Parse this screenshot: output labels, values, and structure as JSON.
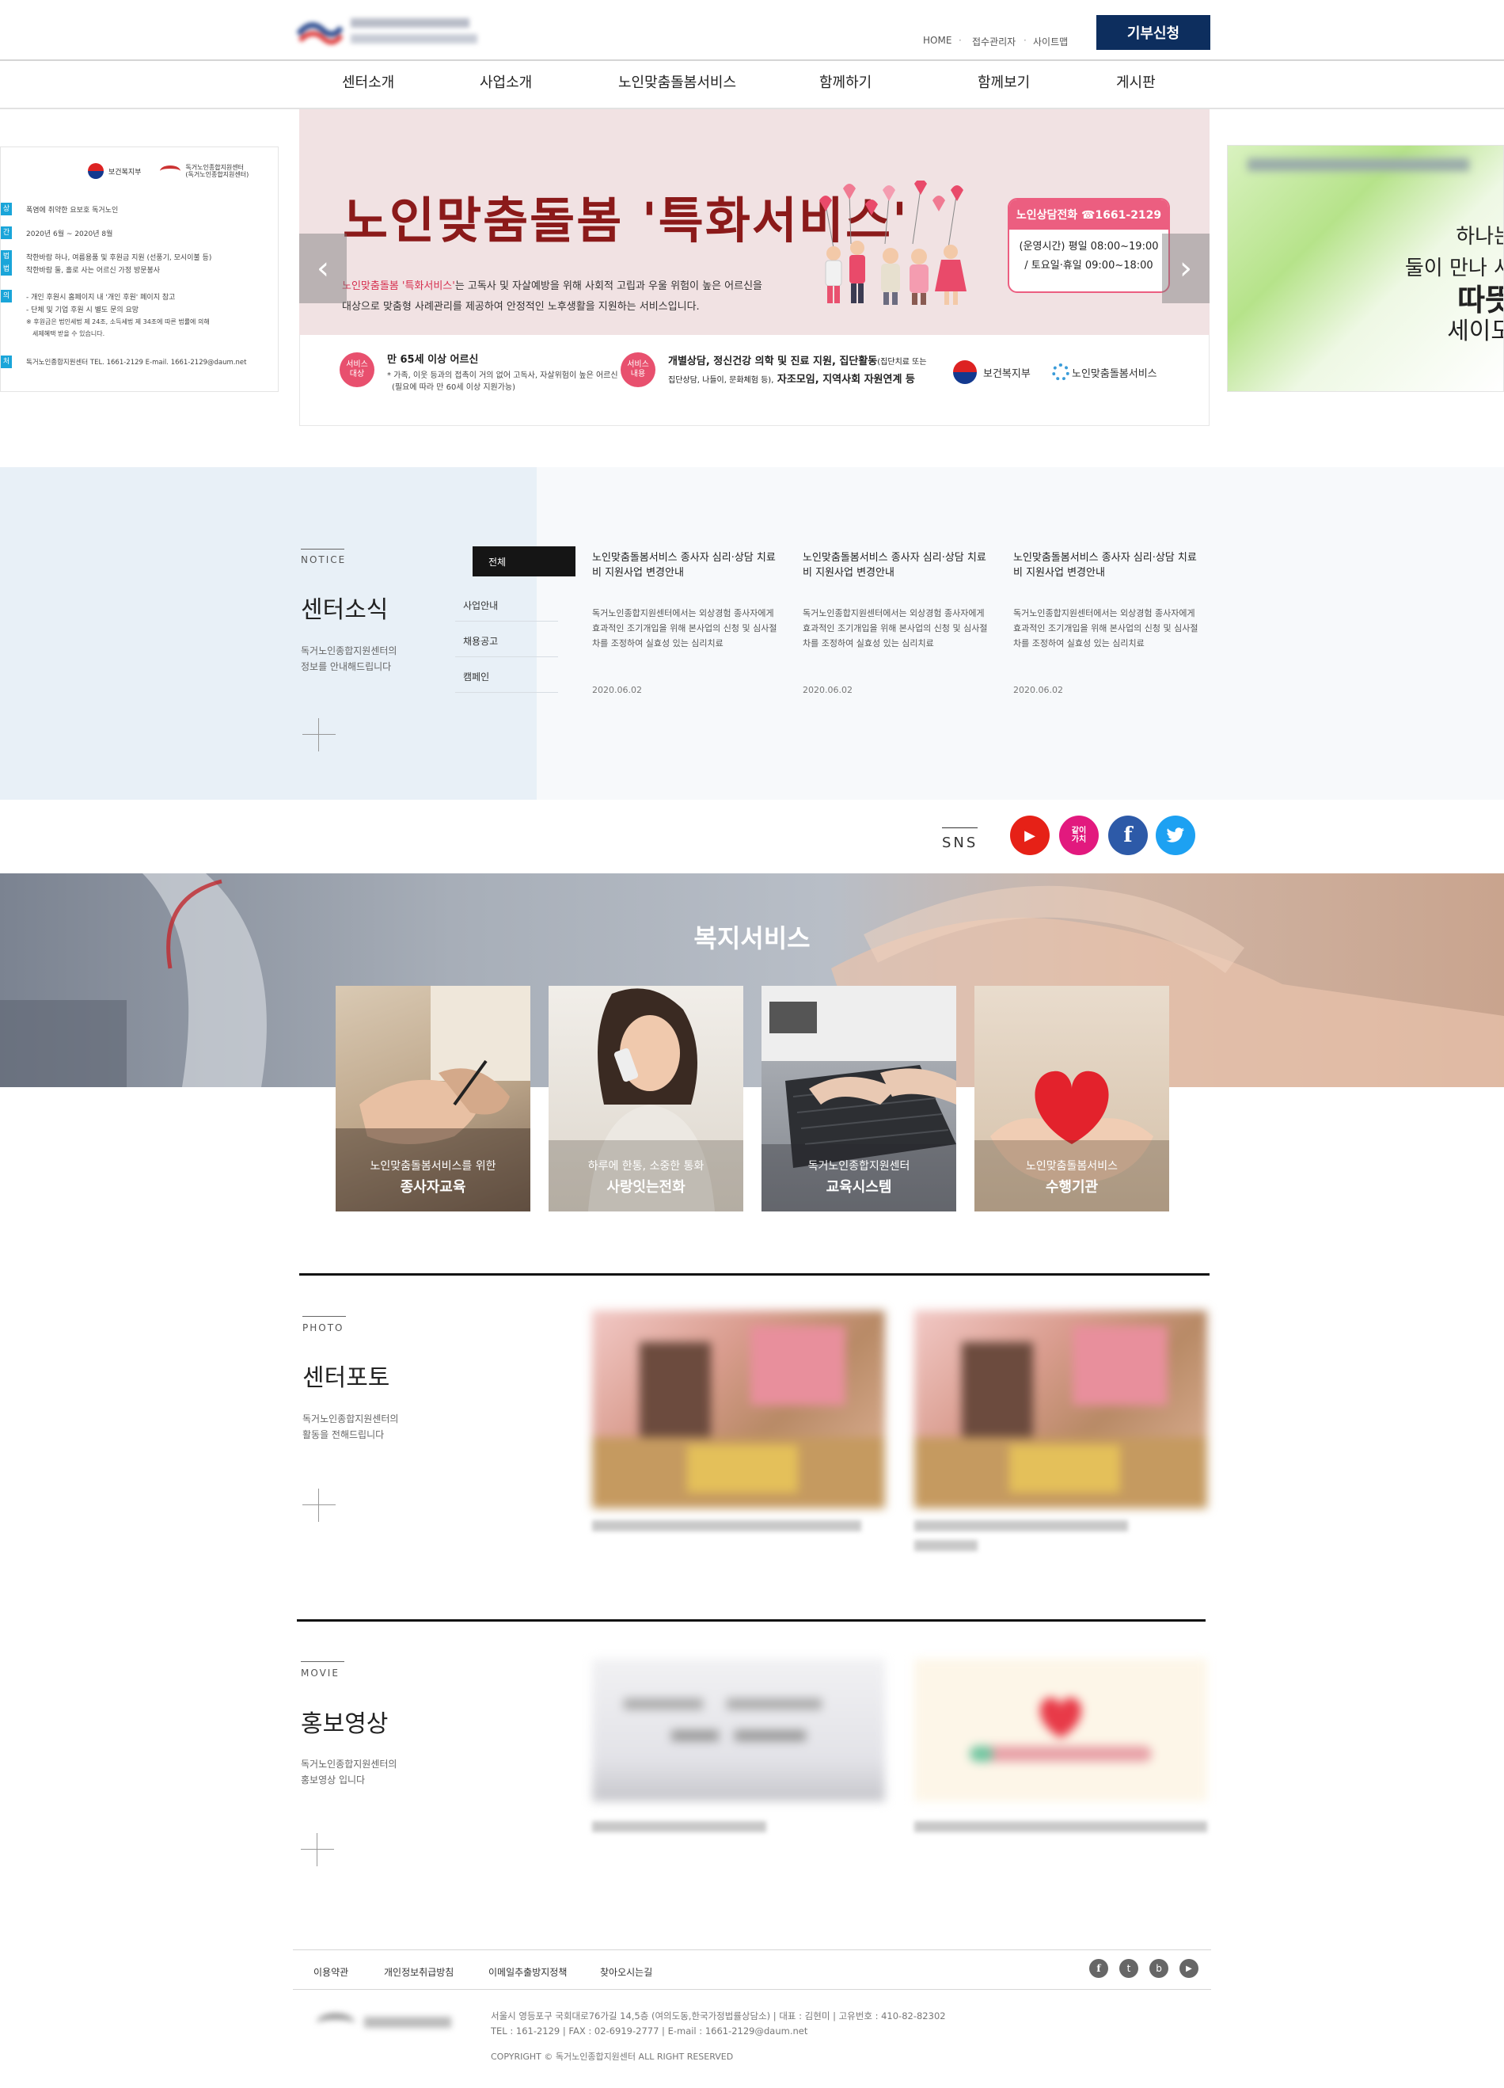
{
  "header": {
    "util_links": [
      "HOME",
      "접수관리자",
      "사이트맵"
    ],
    "donate_label": "기부신청",
    "gnb": [
      "센터소개",
      "사업소개",
      "노인맞춤돌봄서비스",
      "함께하기",
      "함께보기",
      "게시판"
    ]
  },
  "left_card": {
    "org1": "보건복지부",
    "org2": "독거노인종합지원센터",
    "org2_sub": "(독거노인종합지원센터)",
    "lines": [
      "폭염에 취약한 요보호 독거노인",
      "2020년 6월 ~ 2020년 8월",
      "착한바람 하나, 여름용품 및 후원금 지원 (선풍기, 모시이불 등)",
      "착한바람 둘, 홀로 사는 어르신 가정 방문봉사",
      "- 개인 후원시 홈페이지 내 '개인 후원' 페이지 참고",
      "- 단체 및 기업 후원 시 별도 문의 요망",
      "※ 후원금은 법인세법 제 24조, 소득세법 제 34조에 따른 법률에 의해",
      "세제혜택 받을 수 있습니다.",
      "독거노인종합지원센터  TEL. 1661-2129   E-mail. 1661-2129@daum.net"
    ],
    "tags": [
      "상",
      "간",
      "법",
      "법",
      "의",
      "처"
    ]
  },
  "banner": {
    "title": "노인맞춤돌봄 '특화서비스'",
    "desc_highlight": "노인맞춤돌봄 '특화서비스'",
    "desc_rest_1": "는 고독사 및 자살예방을 위해 사회적 고립과 우울 위험이 높은 어르신을",
    "desc_line_2": "대상으로 맞춤형 사례관리를 제공하여 안정적인 노후생활을 지원하는 서비스입니다.",
    "phone_head": "노인상담전화 ☎1661-2129",
    "phone_line1": "(운영시간) 평일 08:00~19:00",
    "phone_line2": "/ 토요일·휴일 09:00~18:00",
    "badge1": "서비스\n대상",
    "target_title": "만 65세 이상 어르신",
    "target_desc1": "* 가족, 이웃 등과의 접촉이 거의 없어 고독사, 자살위험이 높은 어르신",
    "target_desc2": "(필요에 따라 만 60세 이상 지원가능)",
    "badge2": "서비스\n내용",
    "content_title_bold": "개별상담, 정신건강 의학 및 진료 지원, 집단활동",
    "content_title_small": "(집단치료 또는",
    "content_line2_small": "집단상담, 나들이, 문화체험 등),",
    "content_line2_bold": " 자조모임, 지역사회 자원연계 등",
    "logo1": "보건복지부",
    "logo2": "노인맞춤돌봄서비스",
    "prev": "‹",
    "next": "›"
  },
  "right_card": {
    "text1": "하나는",
    "text2": "둘이 만나 사",
    "text3": "따뜻",
    "text4": "세이도"
  },
  "notice": {
    "eng": "NOTICE",
    "title": "센터소식",
    "desc1": "독거노인종합지원센터의",
    "desc2": "정보를 안내해드립니다",
    "tabs": [
      "전체",
      "사업안내",
      "채용공고",
      "캠페인"
    ],
    "posts": [
      {
        "title": "노인맞춤돌봄서비스 종사자 심리·상담 치료비 지원사업 변경안내",
        "body": "독거노인종합지원센터에서는 외상경험 종사자에게 효과적인 조기개입을 위해 본사업의 신청 및 심사절차를 조정하여 실효성 있는 심리치료",
        "date": "2020.06.02"
      },
      {
        "title": "노인맞춤돌봄서비스 종사자 심리·상담 치료비 지원사업 변경안내",
        "body": "독거노인종합지원센터에서는 외상경험 종사자에게 효과적인 조기개입을 위해 본사업의 신청 및 심사절차를 조정하여 실효성 있는 심리치료",
        "date": "2020.06.02"
      },
      {
        "title": "노인맞춤돌봄서비스 종사자 심리·상담 치료비 지원사업 변경안내",
        "body": "독거노인종합지원센터에서는 외상경험 종사자에게 효과적인 조기개입을 위해 본사업의 신청 및 심사절차를 조정하여 실효성 있는 심리치료",
        "date": "2020.06.02"
      }
    ]
  },
  "sns": {
    "label": "SNS",
    "kakao_label": "같이\n가치",
    "youtube": "▶",
    "facebook": "f",
    "twitter": "🐦"
  },
  "welfare": {
    "title": "복지서비스",
    "cards": [
      {
        "sub": "노인맞춤돌봄서비스를 위한",
        "name": "종사자교육"
      },
      {
        "sub": "하루에 한통, 소중한 통화",
        "name": "사랑잇는전화"
      },
      {
        "sub": "독거노인종합지원센터",
        "name": "교육시스템"
      },
      {
        "sub": "노인맞춤돌봄서비스",
        "name": "수행기관"
      }
    ]
  },
  "photo": {
    "eng": "PHOTO",
    "title": "센터포토",
    "desc1": "독거노인종합지원센터의",
    "desc2": "활동을 전해드립니다"
  },
  "movie": {
    "eng": "MOVIE",
    "title": "홍보영상",
    "desc1": "독거노인종합지원센터의",
    "desc2": "홍보영상 입니다"
  },
  "footer": {
    "links": [
      "이용약관",
      "개인정보취급방침",
      "이메일추출방지정책",
      "찾아오시는길"
    ],
    "icons": [
      "f",
      "t",
      "b",
      "▶"
    ],
    "address": "서울시 영등포구 국회대로76가길 14,5층 (여의도동,한국가정법률상담소)   |   대표 : 김현미   |   고유번호 : 410-82-82302",
    "contact": "TEL : 161-2129   |   FAX : 02-6919-2777   |   E-mail : 1661-2129@daum.net",
    "copyright": "COPYRIGHT © 독거노인종합지원센터 ALL RIGHT RESERVED"
  }
}
